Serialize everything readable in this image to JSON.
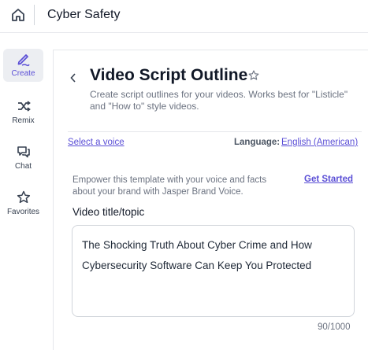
{
  "header": {
    "home_icon": "home-icon",
    "workspace_title": "Cyber Safety"
  },
  "sidebar": {
    "items": [
      {
        "label": "Create",
        "icon": "pen-icon",
        "active": true
      },
      {
        "label": "Remix",
        "icon": "shuffle-icon",
        "active": false
      },
      {
        "label": "Chat",
        "icon": "chat-icon",
        "active": false
      },
      {
        "label": "Favorites",
        "icon": "star-icon",
        "active": false
      }
    ]
  },
  "page": {
    "title": "Video Script Outline",
    "description": "Create script outlines for your videos. Works best for \"Listicle\" and \"How to\" style videos."
  },
  "voice": {
    "select_voice": "Select a voice",
    "language_label": "Language:",
    "language_value": "English (American)"
  },
  "brand_voice": {
    "text": "Empower this template with your voice and facts about your brand with Jasper Brand Voice.",
    "cta": "Get Started"
  },
  "form": {
    "field_label": "Video title/topic",
    "field_value": "The Shocking Truth About Cyber Crime and How Cybersecurity Software Can Keep You Protected",
    "char_count": "90/1000"
  },
  "colors": {
    "accent": "#5b4fd6",
    "active_bg": "#eceef2"
  }
}
